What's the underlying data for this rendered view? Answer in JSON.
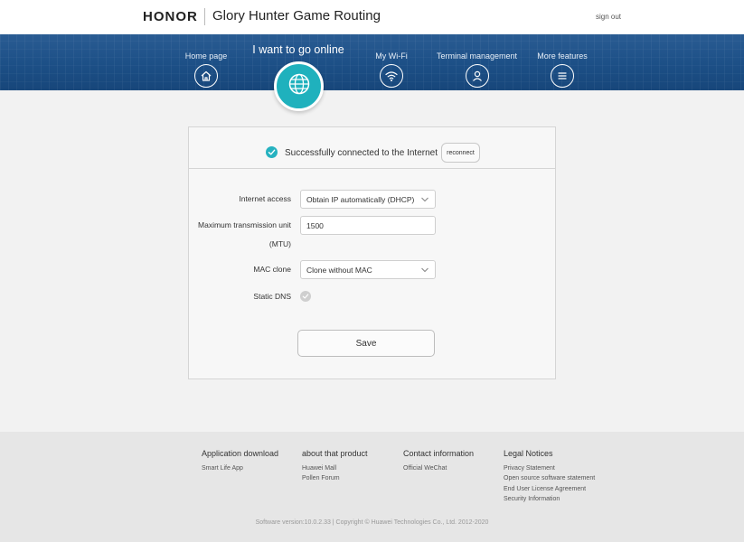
{
  "header": {
    "brand": "HONOR",
    "title": "Glory Hunter Game Routing",
    "signout": "sign out"
  },
  "nav": {
    "items": [
      {
        "label": "Home page",
        "icon": "home-icon"
      },
      {
        "label": "I want to go online",
        "icon": "globe-icon",
        "active": true
      },
      {
        "label": "My Wi-Fi",
        "icon": "wifi-icon"
      },
      {
        "label": "Terminal management",
        "icon": "user-icon"
      },
      {
        "label": "More features",
        "icon": "menu-icon"
      }
    ]
  },
  "status": {
    "text": "Successfully connected to the Internet",
    "reconnect": "reconnect"
  },
  "form": {
    "internet_access_label": "Internet access",
    "internet_access_value": "Obtain IP automatically (DHCP)",
    "mtu_label_line1": "Maximum transmission unit",
    "mtu_label_line2": "(MTU)",
    "mtu_value": "1500",
    "mac_clone_label": "MAC clone",
    "mac_clone_value": "Clone without MAC",
    "static_dns_label": "Static DNS",
    "save": "Save"
  },
  "footer": {
    "columns": [
      {
        "title": "Application download",
        "links": [
          "Smart Life App"
        ]
      },
      {
        "title": "about that product",
        "links": [
          "Huawei Mall",
          "Pollen Forum"
        ]
      },
      {
        "title": "Contact information",
        "links": [
          "Official WeChat"
        ]
      },
      {
        "title": "Legal Notices",
        "links": [
          "Privacy Statement",
          "Open source software statement",
          "End User License Agreement",
          "Security Information"
        ]
      }
    ],
    "copyright": "Software version:10.0.2.33 | Copyright © Huawei Technologies Co., Ltd. 2012-2020"
  },
  "colors": {
    "accent": "#26b2c0",
    "nav_bg": "#1c4f86"
  }
}
